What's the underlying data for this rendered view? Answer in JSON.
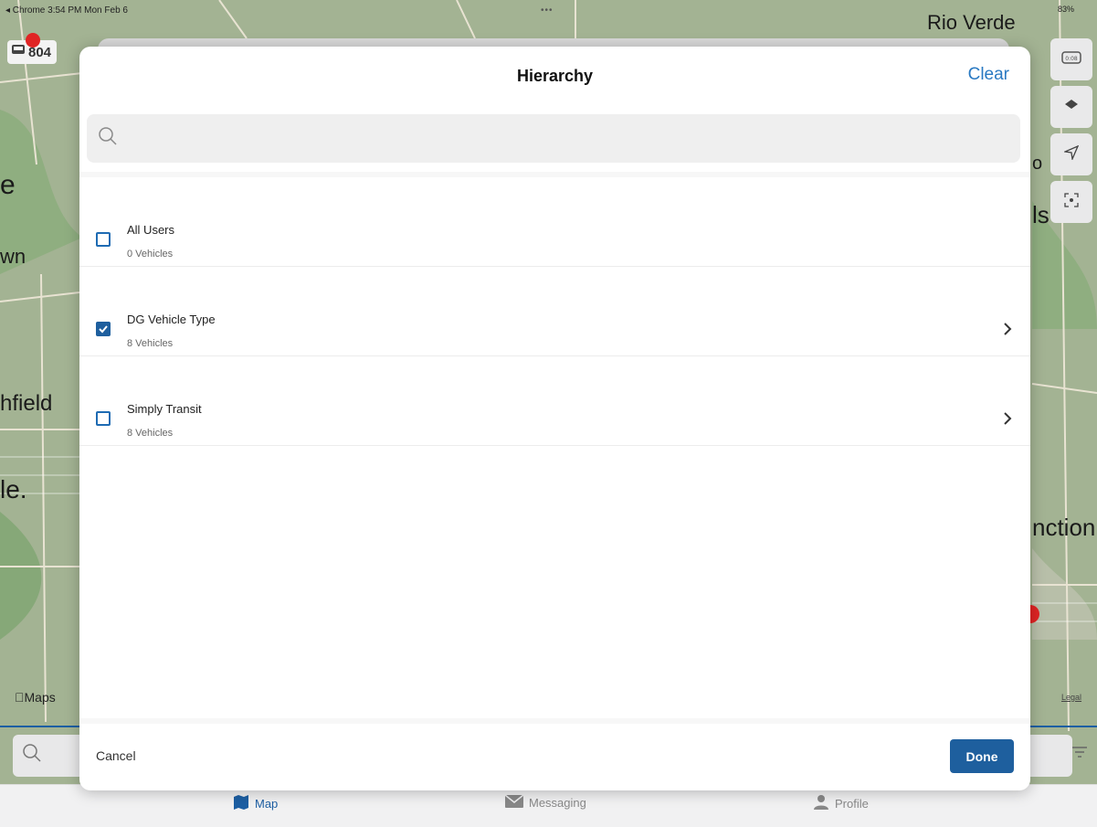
{
  "status_bar": {
    "left": "◂ Chrome  3:54 PM  Mon Feb 6",
    "center": "•••",
    "battery": "83%"
  },
  "map": {
    "vehicle_badge": "804",
    "labels": {
      "rio_verde": "Rio Verde",
      "e": "e",
      "wn": "wn",
      "hfield": "hfield",
      "le": "le.",
      "ls": "ls",
      "o": "o",
      "nction": "nction"
    },
    "attribution": "Maps",
    "legal": "Legal",
    "colors": {
      "land": "#9fb18f",
      "green": "#7fa873",
      "road": "#e8e3d2"
    }
  },
  "tabs": [
    {
      "label": "Map",
      "icon": "map-icon",
      "active": true
    },
    {
      "label": "Messaging",
      "icon": "envelope-icon",
      "active": false
    },
    {
      "label": "Profile",
      "icon": "person-icon",
      "active": false
    }
  ],
  "modal": {
    "title": "Hierarchy",
    "clear_label": "Clear",
    "search": {
      "value": "",
      "placeholder": ""
    },
    "items": [
      {
        "name": "All Users",
        "count": "0 Vehicles",
        "checked": false,
        "has_children": false
      },
      {
        "name": "DG Vehicle Type",
        "count": "8 Vehicles",
        "checked": true,
        "has_children": true
      },
      {
        "name": "Simply Transit",
        "count": "8 Vehicles",
        "checked": false,
        "has_children": true
      }
    ],
    "cancel_label": "Cancel",
    "done_label": "Done",
    "accent": "#1e5f9e",
    "link_color": "#2979c2"
  }
}
